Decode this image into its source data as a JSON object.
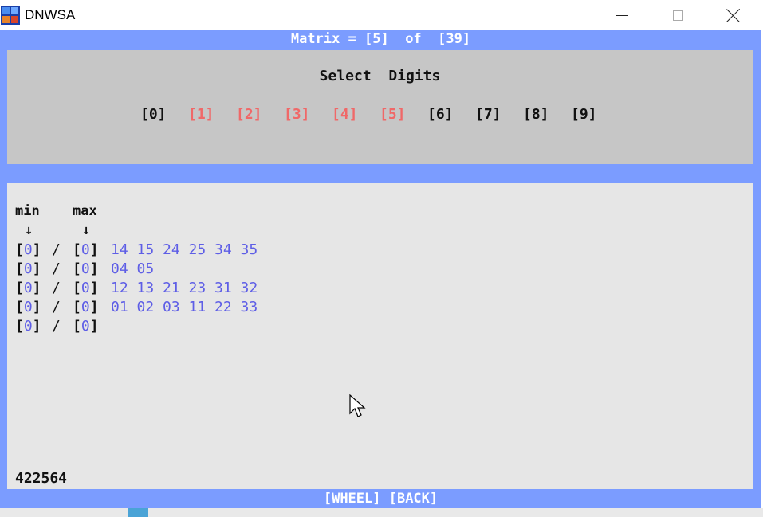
{
  "window": {
    "title": "DNWSA",
    "icon": "dnwsa-app-icon"
  },
  "header": {
    "text": "Matrix = [5]  of  [39]"
  },
  "digit_panel": {
    "title": "Select  Digits",
    "digits": [
      {
        "label": "[0]",
        "selected": false
      },
      {
        "label": "[1]",
        "selected": true
      },
      {
        "label": "[2]",
        "selected": true
      },
      {
        "label": "[3]",
        "selected": true
      },
      {
        "label": "[4]",
        "selected": true
      },
      {
        "label": "[5]",
        "selected": true
      },
      {
        "label": "[6]",
        "selected": false
      },
      {
        "label": "[7]",
        "selected": false
      },
      {
        "label": "[8]",
        "selected": false
      },
      {
        "label": "[9]",
        "selected": false
      }
    ]
  },
  "matrix": {
    "min_label": "min",
    "max_label": "max",
    "arrow": "↓",
    "rows": [
      {
        "min": "0",
        "max": "0",
        "numbers": "14 15 24 25 34 35"
      },
      {
        "min": "0",
        "max": "0",
        "numbers": "04 05"
      },
      {
        "min": "0",
        "max": "0",
        "numbers": "12 13 21 23 31 32"
      },
      {
        "min": "0",
        "max": "0",
        "numbers": "01 02 03 11 22 33"
      },
      {
        "min": "0",
        "max": "0",
        "numbers": ""
      }
    ]
  },
  "total": "422564",
  "footer": {
    "text": "[WHEEL] [BACK]"
  },
  "colors": {
    "frame": "#7b9cff",
    "panel": "#c6c6c6",
    "matrix_bg": "#e6e6e6",
    "selected_digit": "#f06868",
    "value_blue": "#5e5ee6"
  }
}
